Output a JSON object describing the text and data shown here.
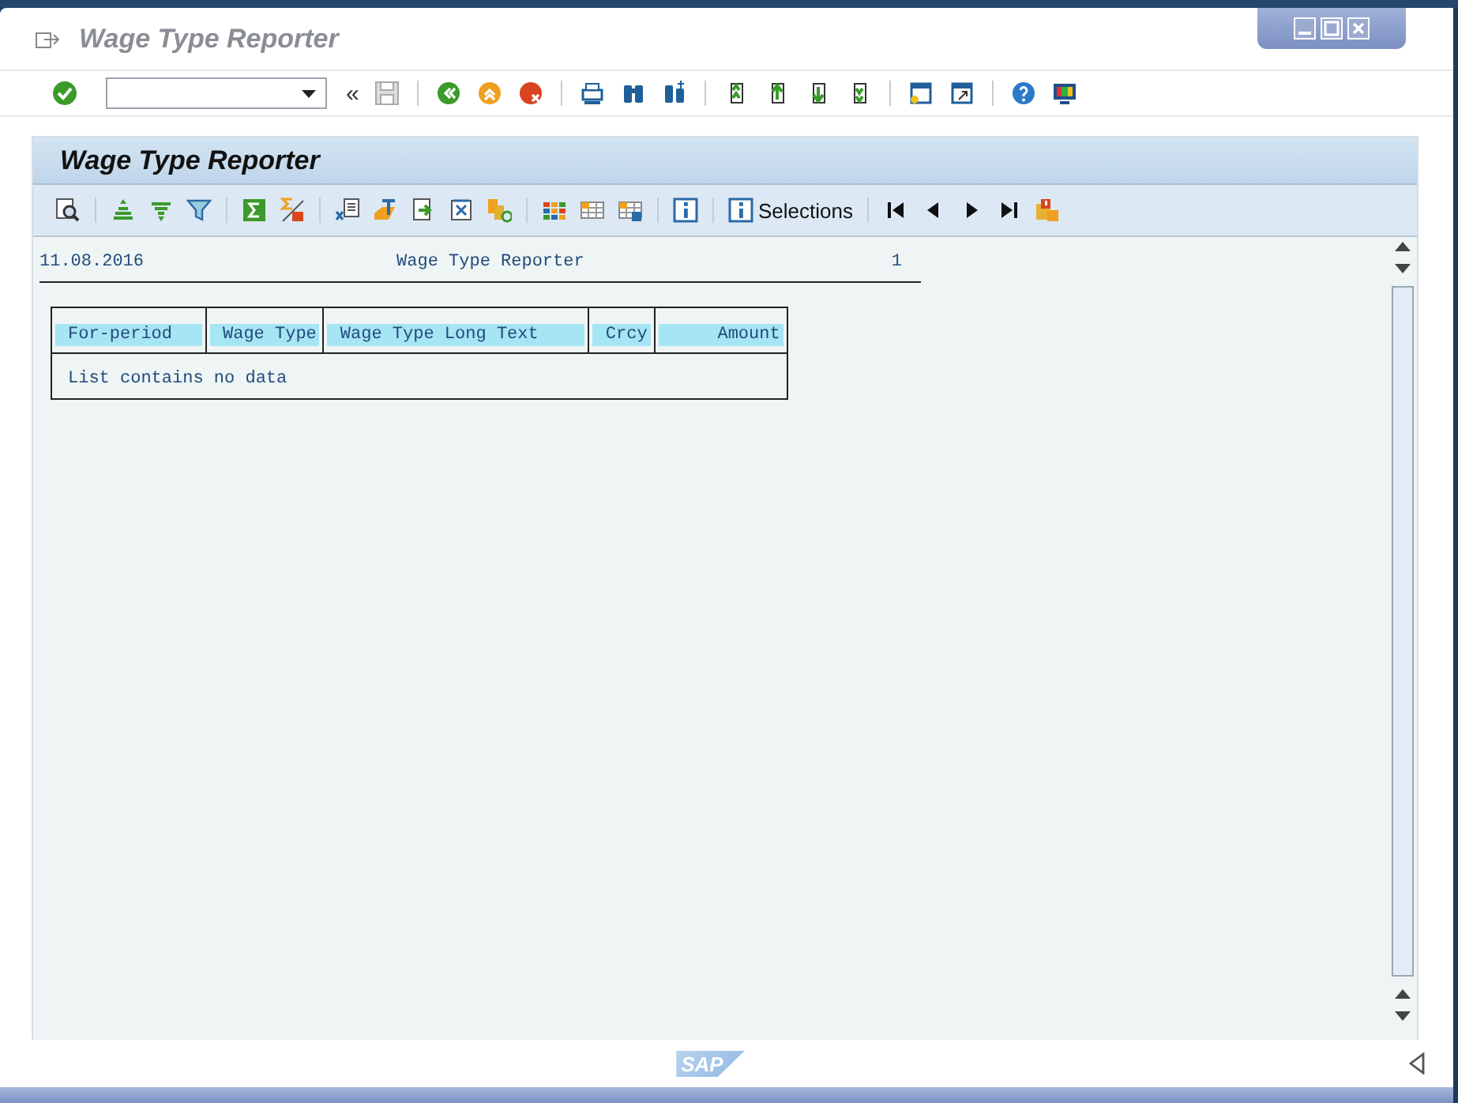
{
  "window": {
    "title": "Wage Type Reporter",
    "history_button": "«"
  },
  "panel": {
    "title": "Wage Type Reporter",
    "selections_button": "Selections"
  },
  "report": {
    "date": "11.08.2016",
    "title": "Wage Type Reporter",
    "page": "1",
    "columns": [
      {
        "label": "For-period",
        "kind": "text"
      },
      {
        "label": "Wage Type",
        "kind": "text"
      },
      {
        "label": "Wage Type Long Text",
        "kind": "text"
      },
      {
        "label": "Crcy",
        "kind": "text"
      },
      {
        "label": "Amount",
        "kind": "amount"
      }
    ],
    "empty_message": "List contains no data"
  },
  "footer": {
    "logo": "SAP"
  }
}
